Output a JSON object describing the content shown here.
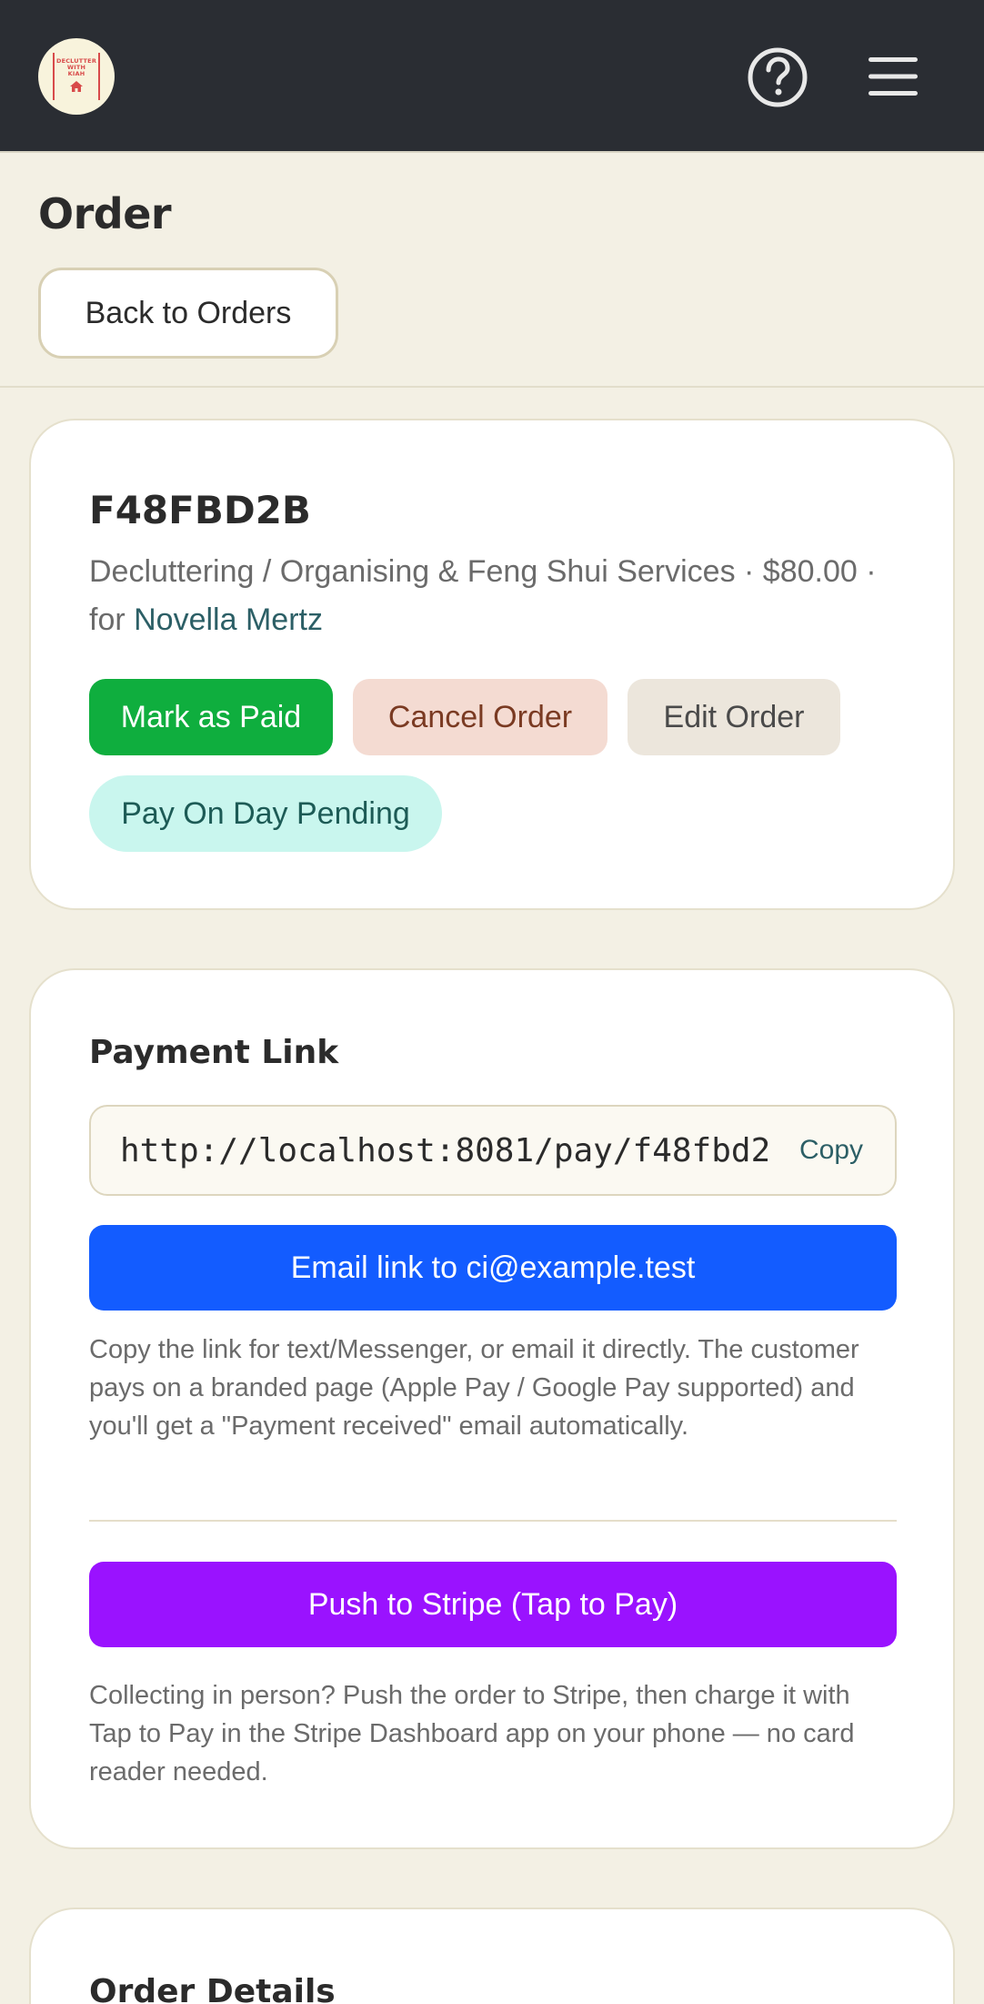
{
  "header": {
    "logo_lines": [
      "DECLUTTER",
      "WITH",
      "KIAH"
    ],
    "help_icon": "question-circle-icon",
    "menu_icon": "hamburger-menu-icon"
  },
  "page": {
    "title": "Order",
    "back_label": "Back to Orders"
  },
  "order": {
    "id": "F48FBD2B",
    "service_line": "Decluttering / Organising & Feng Shui Services · $80.00 · for ",
    "customer": "Novella Mertz",
    "actions": {
      "mark_paid": "Mark as Paid",
      "cancel": "Cancel Order",
      "edit": "Edit Order"
    },
    "status": "Pay On Day Pending"
  },
  "payment": {
    "title": "Payment Link",
    "link_value": "http://localhost:8081/pay/f48fbd2b",
    "copy_label": "Copy",
    "email_label": "Email link to ci@example.test",
    "email_help": "Copy the link for text/Messenger, or email it directly. The customer pays on a branded page (Apple Pay / Google Pay supported) and you'll get a \"Payment received\" email automatically.",
    "stripe_label": "Push to Stripe (Tap to Pay)",
    "stripe_help": "Collecting in person? Push the order to Stripe, then charge it with Tap to Pay in the Stripe Dashboard app on your phone — no card reader needed."
  },
  "details": {
    "title": "Order Details"
  },
  "colors": {
    "topbar": "#2a2d33",
    "paid": "#0fae3e",
    "email": "#135cff",
    "stripe": "#9a12ff",
    "status_bg": "#c9f6ee"
  }
}
